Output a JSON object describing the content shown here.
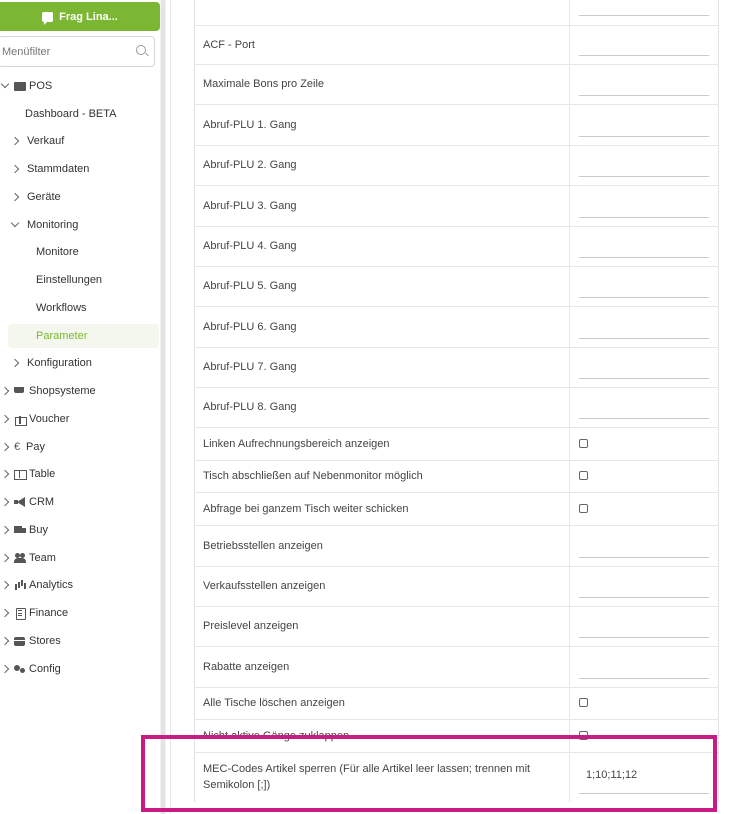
{
  "sidebar": {
    "ask_button": "Frag Lina...",
    "search_placeholder": "Menüfilter",
    "items": [
      {
        "label": "POS",
        "icon": "cash-register-icon"
      },
      {
        "label": "Dashboard - BETA"
      },
      {
        "label": "Verkauf"
      },
      {
        "label": "Stammdaten"
      },
      {
        "label": "Geräte"
      },
      {
        "label": "Monitoring"
      },
      {
        "label": "Monitore"
      },
      {
        "label": "Einstellungen"
      },
      {
        "label": "Workflows"
      },
      {
        "label": "Parameter"
      },
      {
        "label": "Konfiguration"
      },
      {
        "label": "Shopsysteme",
        "icon": "cart-icon"
      },
      {
        "label": "Voucher",
        "icon": "gift-icon"
      },
      {
        "label": "Pay",
        "icon": "euro-icon"
      },
      {
        "label": "Table",
        "icon": "book-icon"
      },
      {
        "label": "CRM",
        "icon": "megaphone-icon"
      },
      {
        "label": "Buy",
        "icon": "truck-icon"
      },
      {
        "label": "Team",
        "icon": "team-icon"
      },
      {
        "label": "Analytics",
        "icon": "chart-icon"
      },
      {
        "label": "Finance",
        "icon": "calculator-icon"
      },
      {
        "label": "Stores",
        "icon": "store-icon"
      },
      {
        "label": "Config",
        "icon": "gears-icon"
      }
    ]
  },
  "params": [
    {
      "label": "",
      "type": "input",
      "value": ""
    },
    {
      "label": "ACF - Port",
      "type": "input",
      "value": ""
    },
    {
      "label": "Maximale Bons pro Zeile",
      "type": "input",
      "value": ""
    },
    {
      "label": "Abruf-PLU 1. Gang",
      "type": "input",
      "value": ""
    },
    {
      "label": "Abruf-PLU 2. Gang",
      "type": "input",
      "value": ""
    },
    {
      "label": "Abruf-PLU 3. Gang",
      "type": "input",
      "value": ""
    },
    {
      "label": "Abruf-PLU 4. Gang",
      "type": "input",
      "value": ""
    },
    {
      "label": "Abruf-PLU 5. Gang",
      "type": "input",
      "value": ""
    },
    {
      "label": "Abruf-PLU 6. Gang",
      "type": "input",
      "value": ""
    },
    {
      "label": "Abruf-PLU 7. Gang",
      "type": "input",
      "value": ""
    },
    {
      "label": "Abruf-PLU 8. Gang",
      "type": "input",
      "value": ""
    },
    {
      "label": "Linken Aufrechnungsbereich anzeigen",
      "type": "checkbox",
      "checked": false
    },
    {
      "label": "Tisch abschließen auf Nebenmonitor möglich",
      "type": "checkbox",
      "checked": false
    },
    {
      "label": "Abfrage bei ganzem Tisch weiter schicken",
      "type": "checkbox",
      "checked": false
    },
    {
      "label": "Betriebsstellen anzeigen",
      "type": "input",
      "value": ""
    },
    {
      "label": "Verkaufsstellen anzeigen",
      "type": "input",
      "value": ""
    },
    {
      "label": "Preislevel anzeigen",
      "type": "input",
      "value": ""
    },
    {
      "label": "Rabatte anzeigen",
      "type": "input",
      "value": ""
    },
    {
      "label": "Alle Tische löschen anzeigen",
      "type": "checkbox",
      "checked": false
    },
    {
      "label": "Nicht aktive Gänge zuklappen",
      "type": "checkbox",
      "checked": false
    },
    {
      "label": "MEC-Codes Artikel sperren (Für alle Artikel leer lassen; trennen mit Semikolon [;])",
      "type": "input",
      "value": "1;10;11;12"
    }
  ],
  "colors": {
    "accent": "#7cb733",
    "highlight": "#c81c84"
  }
}
